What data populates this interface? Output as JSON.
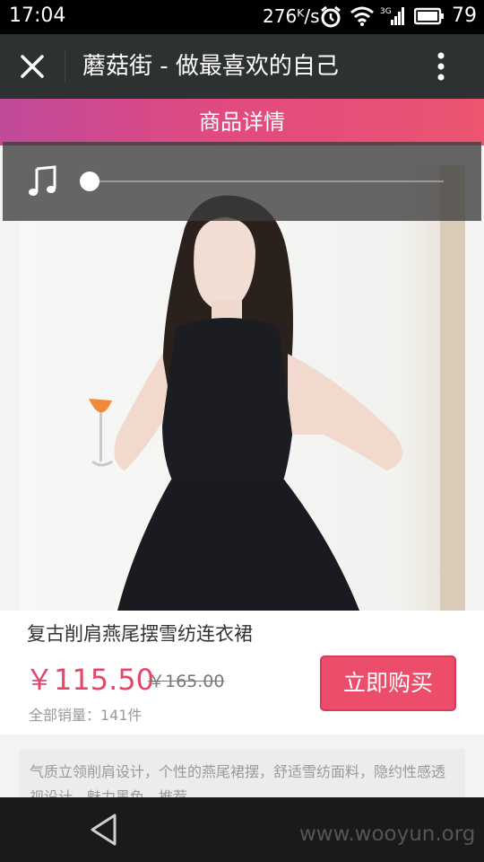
{
  "status_bar": {
    "time": "17:04",
    "net_speed": "276ᴷ/s",
    "battery_level": "79",
    "icons": [
      "alarm-icon",
      "wifi-icon",
      "3g-signal-icon",
      "battery-icon"
    ]
  },
  "title_bar": {
    "title": "蘑菇街 - 做最喜欢的自己",
    "close_icon": "close-icon",
    "menu_icon": "more-vertical-icon"
  },
  "section_bar": {
    "label": "商品详情"
  },
  "music_player": {
    "icon": "music-note-icon",
    "progress": 0
  },
  "product": {
    "image_alt": "product-photo",
    "name": "复古削肩燕尾摆雪纺连衣裙",
    "price": "￥115.50",
    "original_price": "￥165.00",
    "sales": "全部销量：141件",
    "buy_label": "立即购买",
    "description": "气质立领削肩设计，个性的燕尾裙摆，舒适雪纺面料，隐约性感透视设计，魅力黑色，推荐"
  },
  "nav_bar": {
    "back_icon": "back-triangle-icon",
    "watermark": "www.wooyun.org"
  },
  "colors": {
    "accent": "#ec4d6b",
    "title_bar": "#2e3132",
    "gradient_start": "#c14a9a",
    "gradient_end": "#ec5470"
  }
}
